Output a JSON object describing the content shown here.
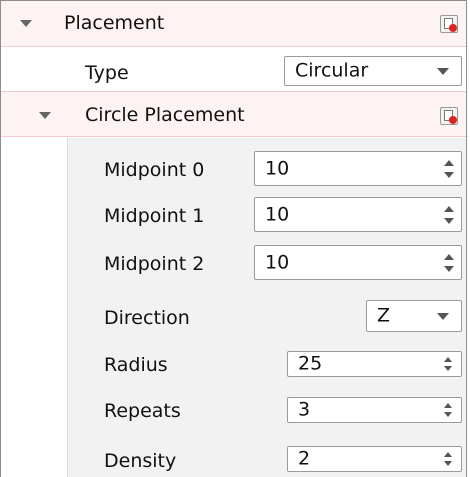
{
  "placement": {
    "label": "Placement"
  },
  "type": {
    "label": "Type",
    "value": "Circular"
  },
  "circle_placement": {
    "label": "Circle Placement",
    "midpoints": [
      {
        "label": "Midpoint 0",
        "value": "10"
      },
      {
        "label": "Midpoint 1",
        "value": "10"
      },
      {
        "label": "Midpoint 2",
        "value": "10"
      }
    ],
    "direction": {
      "label": "Direction",
      "value": "Z"
    },
    "radius": {
      "label": "Radius",
      "value": "25"
    },
    "repeats": {
      "label": "Repeats",
      "value": "3"
    },
    "density": {
      "label": "Density",
      "value": "2"
    }
  },
  "colors": {
    "section_header_bg": "#fdf3f3",
    "section_header_line": "#f2cccc",
    "nested_bg": "#f2f2f2"
  }
}
